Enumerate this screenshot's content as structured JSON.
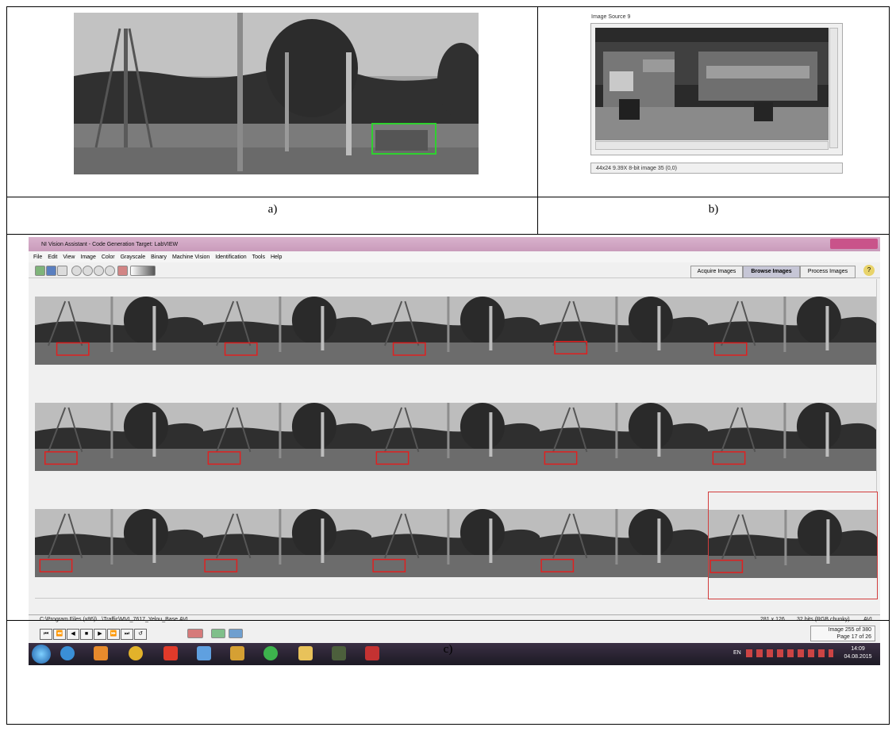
{
  "captions": {
    "a": "a)",
    "b": "b)",
    "c": "c)"
  },
  "image_source": {
    "title": "Image Source 9",
    "status": "44x24 9.39X 8-bit image 35   (0,0)"
  },
  "nva": {
    "title": "NI Vision Assistant - Code Generation Target: LabVIEW",
    "menu": [
      "File",
      "Edit",
      "View",
      "Image",
      "Color",
      "Grayscale",
      "Binary",
      "Machine Vision",
      "Identification",
      "Tools",
      "Help"
    ],
    "modes": [
      "Acquire Images",
      "Browse Images",
      "Process Images"
    ],
    "active_mode": "Browse Images",
    "status_path": "C:\\Program Files (x86)\\...\\Traffic\\MVI_7617_Yelou_Base.AVI",
    "status_size": "281 x 126",
    "status_format": "32 bits (RGB chunky)",
    "status_type": "AVI",
    "image_counter": "Image  255 of 380",
    "page_counter": "Page  17 of 26",
    "player_buttons": [
      "⏮",
      "⏪",
      "◀",
      "■",
      "▶",
      "⏩",
      "⏭",
      "↺"
    ]
  },
  "taskbar": {
    "lang": "EN",
    "time": "14:09",
    "date": "04.08.2015"
  },
  "colors": {
    "detection_box_a": "#2fd12f",
    "detection_box_c": "#e02020",
    "selected_cell": "#d23c3c"
  }
}
